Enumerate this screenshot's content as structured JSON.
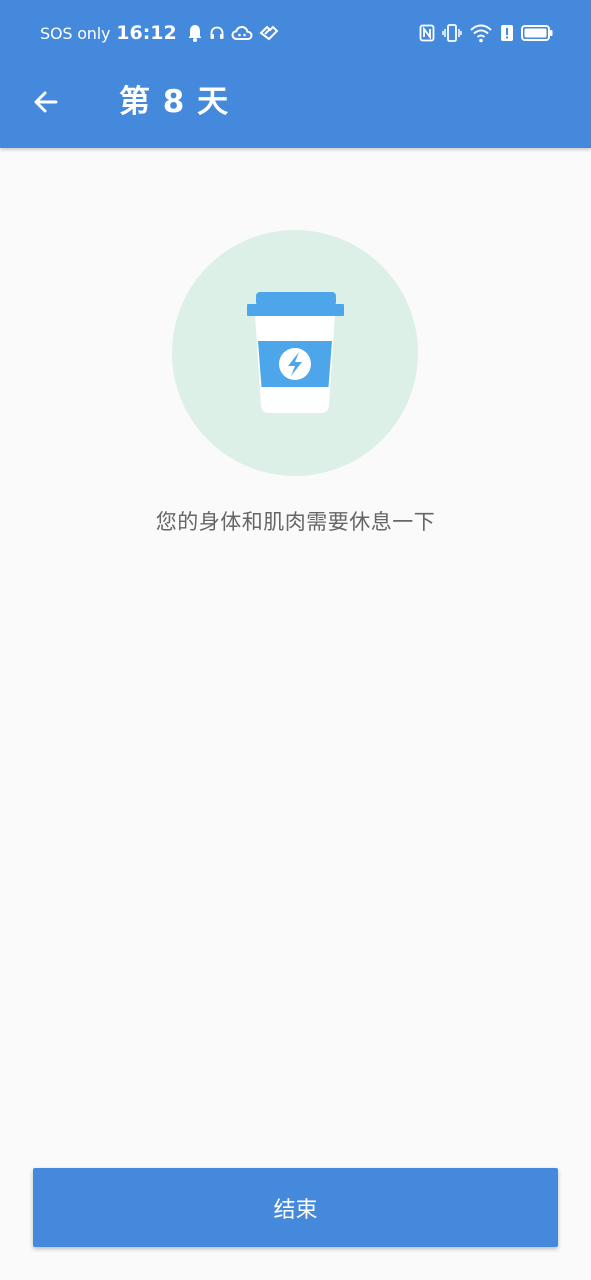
{
  "status_bar": {
    "carrier": "SOS only",
    "time": "16:12",
    "left_icons": [
      "bell-icon",
      "headphones-icon",
      "cloud-icon",
      "hearts-icon"
    ],
    "right_icons": [
      "nfc-icon",
      "vibrate-icon",
      "wifi-icon",
      "alert-icon",
      "battery-icon"
    ]
  },
  "header": {
    "back_icon": "arrow-left-icon",
    "title": "第 8 天"
  },
  "rest": {
    "illustration_icon": "coffee-cup-icon",
    "message": "您的身体和肌肉需要休息一下"
  },
  "actions": {
    "end_label": "结束"
  },
  "colors": {
    "primary": "#4589dc",
    "illustration_bg": "#dcf0e8",
    "cup_blue": "#4ea6ea",
    "text_secondary": "#666666",
    "background": "#fafafa"
  }
}
